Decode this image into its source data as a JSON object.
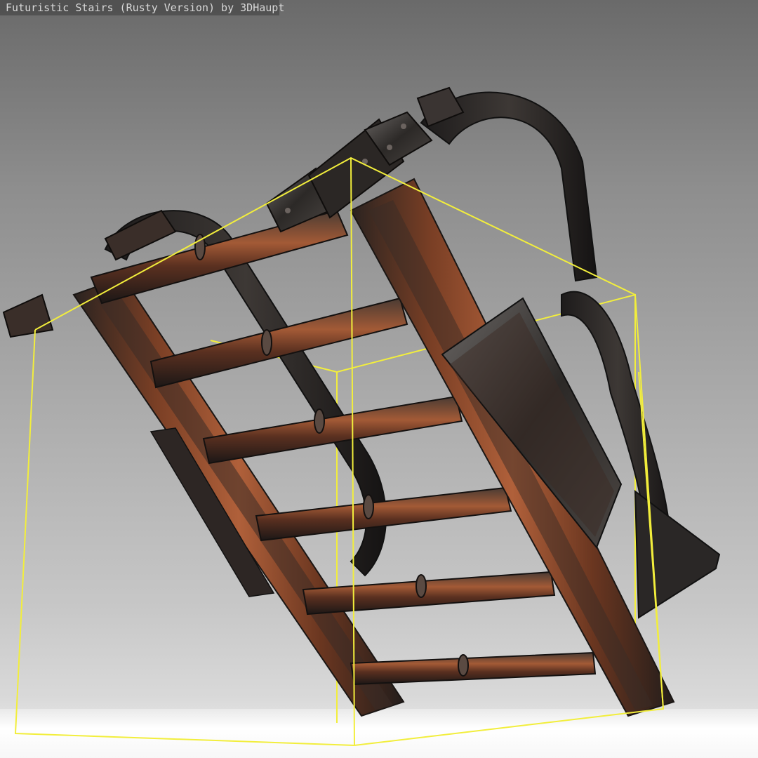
{
  "viewer": {
    "title": "Futuristic Stairs (Rusty Version) by 3DHaupt"
  },
  "colors": {
    "background_top": "#6a6a6a",
    "background_bottom": "#d9d9d9",
    "floor": "#ffffff",
    "bounding_box": "#ffff33",
    "rust": "#9a4f2e",
    "metal_dark": "#2b2522"
  },
  "scene": {
    "model": "rusty-stairs-model",
    "bounding_box_visible": true
  }
}
